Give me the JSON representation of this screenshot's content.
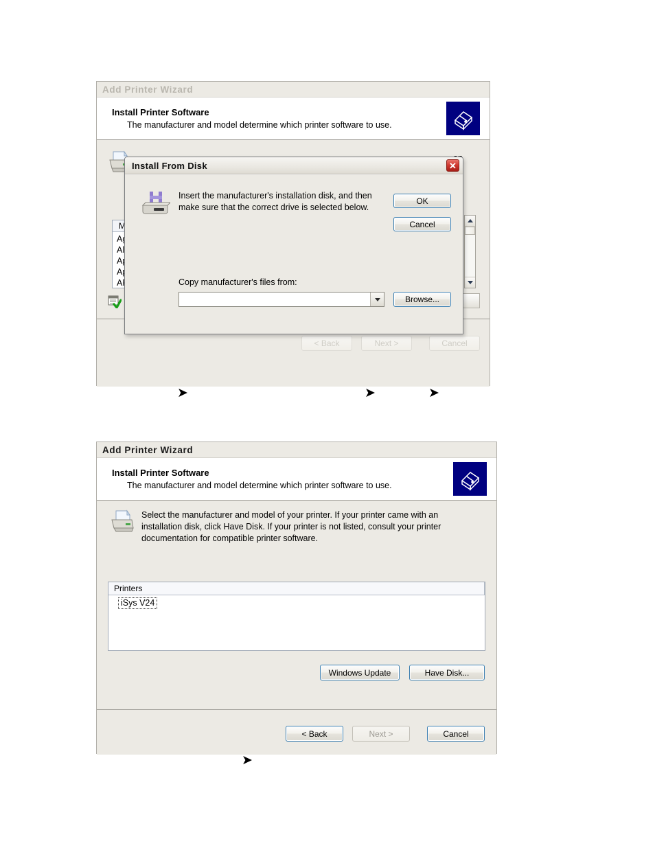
{
  "document": {
    "type": "manual-screenshot-page",
    "figures": 2
  },
  "wizard_top": {
    "window_title": "Add Printer Wizard",
    "header": {
      "title": "Install Printer Software",
      "subtitle": "The manufacturer and model determine which printer software to use.",
      "icon": "printer-header-icon"
    },
    "body_text_fragment": "on",
    "manufacturer_list": {
      "header": "Ma",
      "items": [
        "Agf",
        "Alp",
        "Ap",
        "App",
        "AP",
        "AG"
      ]
    },
    "driver_signing_icon": "driver-signing-icon",
    "footer_buttons": [
      {
        "label": "< Back",
        "state": "faded"
      },
      {
        "label": "Next >",
        "state": "faded"
      },
      {
        "label": "Cancel",
        "state": "faded"
      }
    ]
  },
  "install_from_disk": {
    "title": "Install From Disk",
    "close_label": "✕",
    "icon": "floppy-disk-drive-icon",
    "message": "Insert the manufacturer's installation disk, and then make sure that the correct drive is selected below.",
    "copy_from_label": "Copy manufacturer's files from:",
    "path_value": "",
    "path_placeholder": "",
    "buttons": {
      "ok": "OK",
      "cancel": "Cancel",
      "browse": "Browse..."
    }
  },
  "wizard_bottom": {
    "window_title": "Add Printer Wizard",
    "header": {
      "title": "Install Printer Software",
      "subtitle": "The manufacturer and model determine which printer software to use.",
      "icon": "printer-header-icon"
    },
    "instruction": "Select the manufacturer and model of your printer. If your printer came with an installation disk, click Have Disk. If your printer is not listed, consult your printer documentation for compatible printer software.",
    "printers_list": {
      "column_header": "Printers",
      "items": [
        {
          "label": "iSys V24",
          "focused": true
        }
      ]
    },
    "action_buttons": [
      {
        "label": "Windows Update",
        "state": "enabled"
      },
      {
        "label": "Have Disk...",
        "state": "enabled"
      }
    ],
    "footer_buttons": [
      {
        "label": "< Back",
        "state": "enabled-focus"
      },
      {
        "label": "Next >",
        "state": "disabled"
      },
      {
        "label": "Cancel",
        "state": "enabled-focus"
      }
    ]
  },
  "annotations": {
    "marker_glyph": "➤",
    "top_markers": 3,
    "bottom_markers": 1
  },
  "colors": {
    "window_face": "#eceae4",
    "header_band": "#ffffff",
    "header_icon_bg": "#000080",
    "close_button": "#c63a2e",
    "focus_border": "#3c7fb1",
    "list_border": "#9fa8b5"
  }
}
